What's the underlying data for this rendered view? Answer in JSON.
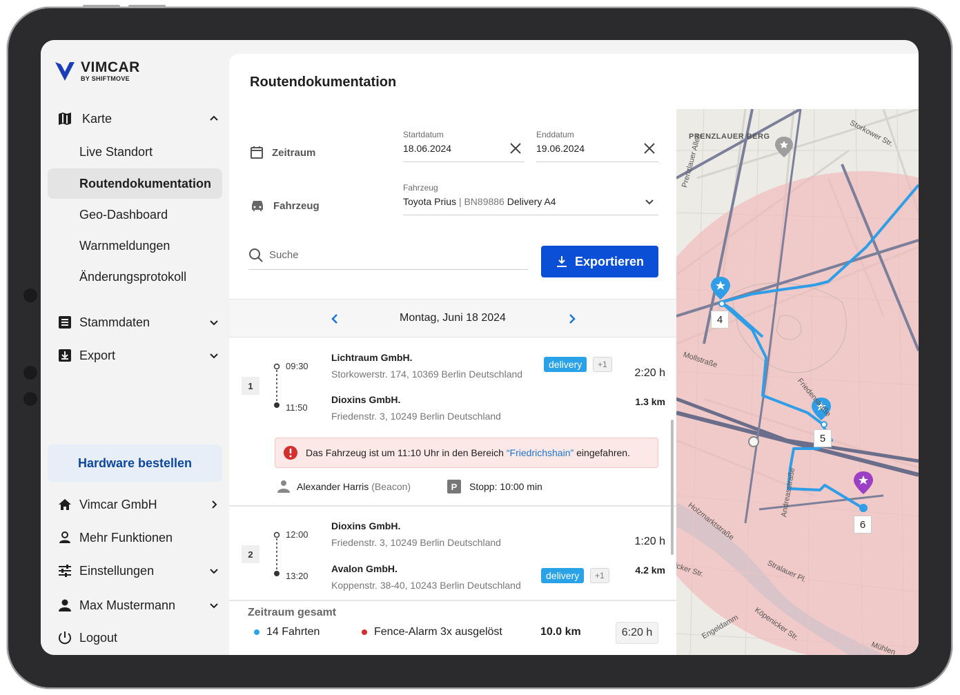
{
  "brand": {
    "name": "VIMCAR",
    "sub": "BY SHIFTMOVE"
  },
  "sidebar": {
    "karte": "Karte",
    "sub_items": [
      "Live Standort",
      "Routendokumentation",
      "Geo-Dashboard",
      "Warnmeldungen",
      "Änderungsprotokoll"
    ],
    "stammdaten": "Stammdaten",
    "export": "Export",
    "hardware": "Hardware bestellen",
    "company": "Vimcar GmbH",
    "more": "Mehr Funktionen",
    "settings": "Einstellungen",
    "user": "Max Mustermann",
    "logout": "Logout"
  },
  "main": {
    "title": "Routendokumentation",
    "zeitraum_label": "Zeitraum",
    "fahrzeug_label": "Fahrzeug",
    "start_caption": "Startdatum",
    "start_value": "18.06.2024",
    "end_caption": "Enddatum",
    "end_value": "19.06.2024",
    "vehicle_caption": "Fahrzeug",
    "vehicle_name": "Toyota Prius",
    "vehicle_sep": "|",
    "vehicle_plate": "BN89886",
    "vehicle_desc": "Delivery A4",
    "search_placeholder": "Suche",
    "export_label": "Exportieren",
    "day_label": "Montag, Juni 18 2024"
  },
  "trips": [
    {
      "num": "1",
      "start_time": "09:30",
      "end_time": "11:50",
      "from_company": "Lichtraum GmbH.",
      "from_addr": "Storkowerstr. 174, 10369 Berlin Deutschland",
      "to_company": "Dioxins GmbH.",
      "to_addr": "Friedenstr. 3, 10249 Berlin Deutschland",
      "tag": "delivery",
      "tag_more": "+1",
      "duration": "2:20 h",
      "distance": "1.3 km",
      "alert_pre": "Das Fahrzeug ist um 11:10 Uhr in den Bereich",
      "alert_link": "“Friedrichshain”",
      "alert_post": "eingefahren.",
      "driver": "Alexander Harris",
      "driver_note": "(Beacon)",
      "stop_badge": "P",
      "stop": "Stopp: 10:00 min"
    },
    {
      "num": "2",
      "start_time": "12:00",
      "end_time": "13:20",
      "from_company": "Dioxins GmbH.",
      "from_addr": "Friedenstr. 3, 10249 Berlin Deutschland",
      "to_company": "Avalon GmbH.",
      "to_addr": "Koppenstr. 38-40, 10243 Berlin Deutschland",
      "tag": "delivery",
      "tag_more": "+1",
      "duration": "1:20 h",
      "distance": "4.2 km"
    }
  ],
  "summary": {
    "title": "Zeitraum gesamt",
    "trips": "14 Fahrten",
    "alarms": "Fence-Alarm 3x ausgelöst",
    "distance": "10.0 km",
    "time": "6:20 h"
  },
  "map": {
    "labels": [
      "PRENZLAUER BERG",
      "Prenzlauer Allee",
      "Storkower Str.",
      "Mollstraße",
      "Friedenstraße",
      "Andreasstraße",
      "Holzmarktstraße",
      "Stralauer Pl.",
      "Köpenicker Str.",
      "Engeldamm",
      "Köpenicker Str.",
      "Mühlen"
    ],
    "markers": [
      "4",
      "5",
      "6"
    ],
    "colors": {
      "fence": "#f2b8b8",
      "route": "#2f9ee6",
      "water": "#a9dbea"
    }
  },
  "colors": {
    "accent": "#0b4fd6",
    "tag": "#2aa2e8",
    "alert_bg": "#fde8e8",
    "alert_icon": "#d32f2f"
  }
}
